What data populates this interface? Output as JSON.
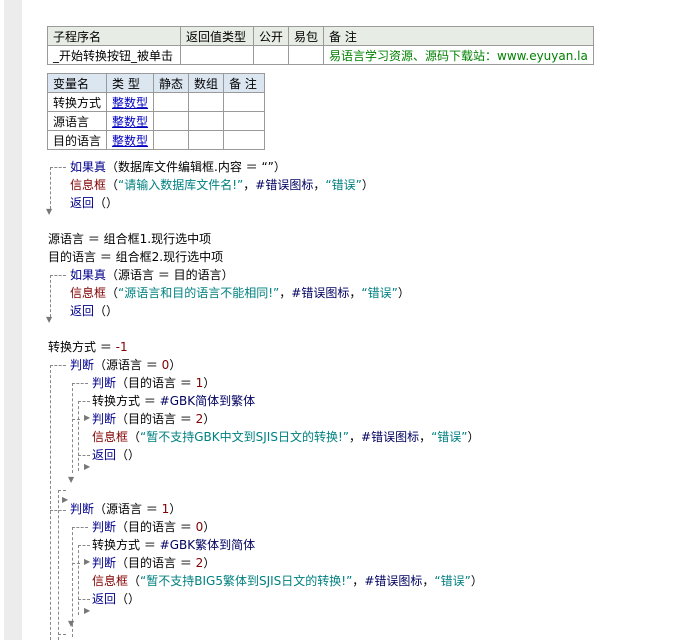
{
  "subroutine_table": {
    "headers": [
      "子程序名",
      "返回值类型",
      "公开",
      "易包",
      "备 注"
    ],
    "row": [
      "_开始转换按钮_被单击",
      "",
      "",
      "",
      "易语言学习资源、源码下载站：www.eyuyan.la"
    ]
  },
  "variable_table": {
    "headers": [
      "变量名",
      "类 型",
      "静态",
      "数组",
      "备 注"
    ],
    "rows": [
      [
        "转换方式",
        "整数型",
        "",
        "",
        ""
      ],
      [
        "源语言",
        "整数型",
        "",
        "",
        ""
      ],
      [
        "目的语言",
        "整数型",
        "",
        "",
        ""
      ]
    ]
  },
  "code_lines": [
    [
      {
        "c": "kw",
        "t": "如果真"
      },
      {
        "c": "plain",
        "t": "（数据库文件编辑框.内容 ＝ “”）"
      }
    ],
    [
      {
        "c": "fn",
        "t": "信息框"
      },
      {
        "c": "plain",
        "t": "（"
      },
      {
        "c": "str",
        "t": "“请输入数据库文件名!”"
      },
      {
        "c": "plain",
        "t": "，"
      },
      {
        "c": "const",
        "t": "#错误图标"
      },
      {
        "c": "plain",
        "t": "，"
      },
      {
        "c": "str",
        "t": "“错误”"
      },
      {
        "c": "plain",
        "t": "）"
      }
    ],
    [
      {
        "c": "kw",
        "t": "返回"
      },
      {
        "c": "plain",
        "t": "（）"
      }
    ],
    [
      {
        "c": "plain",
        "t": "源语言 ＝ 组合框1.现行选中项"
      }
    ],
    [
      {
        "c": "plain",
        "t": "目的语言 ＝ 组合框2.现行选中项"
      }
    ],
    [
      {
        "c": "kw",
        "t": "如果真"
      },
      {
        "c": "plain",
        "t": "（源语言 ＝ 目的语言）"
      }
    ],
    [
      {
        "c": "fn",
        "t": "信息框"
      },
      {
        "c": "plain",
        "t": "（"
      },
      {
        "c": "str",
        "t": "“源语言和目的语言不能相同!”"
      },
      {
        "c": "plain",
        "t": "，"
      },
      {
        "c": "const",
        "t": "#错误图标"
      },
      {
        "c": "plain",
        "t": "，"
      },
      {
        "c": "str",
        "t": "“错误”"
      },
      {
        "c": "plain",
        "t": "）"
      }
    ],
    [
      {
        "c": "kw",
        "t": "返回"
      },
      {
        "c": "plain",
        "t": "（）"
      }
    ],
    [
      {
        "c": "plain",
        "t": "转换方式 ＝ "
      },
      {
        "c": "num",
        "t": "-1"
      }
    ],
    [
      {
        "c": "kw",
        "t": "判断"
      },
      {
        "c": "plain",
        "t": "（源语言 ＝ "
      },
      {
        "c": "num",
        "t": "0"
      },
      {
        "c": "plain",
        "t": "）"
      }
    ],
    [
      {
        "c": "kw",
        "t": "判断"
      },
      {
        "c": "plain",
        "t": "（目的语言 ＝ "
      },
      {
        "c": "num",
        "t": "1"
      },
      {
        "c": "plain",
        "t": "）"
      }
    ],
    [
      {
        "c": "plain",
        "t": "转换方式 ＝ "
      },
      {
        "c": "const",
        "t": "#GBK简体到繁体"
      }
    ],
    [
      {
        "c": "kw",
        "t": "判断"
      },
      {
        "c": "plain",
        "t": "（目的语言 ＝ "
      },
      {
        "c": "num",
        "t": "2"
      },
      {
        "c": "plain",
        "t": "）"
      }
    ],
    [
      {
        "c": "fn",
        "t": "信息框"
      },
      {
        "c": "plain",
        "t": "（"
      },
      {
        "c": "str",
        "t": "“暂不支持GBK中文到SJIS日文的转换!”"
      },
      {
        "c": "plain",
        "t": "，"
      },
      {
        "c": "const",
        "t": "#错误图标"
      },
      {
        "c": "plain",
        "t": "，"
      },
      {
        "c": "str",
        "t": "“错误”"
      },
      {
        "c": "plain",
        "t": "）"
      }
    ],
    [
      {
        "c": "kw",
        "t": "返回"
      },
      {
        "c": "plain",
        "t": "（）"
      }
    ],
    [
      {
        "c": "kw",
        "t": "判断"
      },
      {
        "c": "plain",
        "t": "（源语言 ＝ "
      },
      {
        "c": "num",
        "t": "1"
      },
      {
        "c": "plain",
        "t": "）"
      }
    ],
    [
      {
        "c": "kw",
        "t": "判断"
      },
      {
        "c": "plain",
        "t": "（目的语言 ＝ "
      },
      {
        "c": "num",
        "t": "0"
      },
      {
        "c": "plain",
        "t": "）"
      }
    ],
    [
      {
        "c": "plain",
        "t": "转换方式 ＝ "
      },
      {
        "c": "const",
        "t": "#GBK繁体到简体"
      }
    ],
    [
      {
        "c": "kw",
        "t": "判断"
      },
      {
        "c": "plain",
        "t": "（目的语言 ＝ "
      },
      {
        "c": "num",
        "t": "2"
      },
      {
        "c": "plain",
        "t": "）"
      }
    ],
    [
      {
        "c": "fn",
        "t": "信息框"
      },
      {
        "c": "plain",
        "t": "（"
      },
      {
        "c": "str",
        "t": "“暂不支持BIG5繁体到SJIS日文的转换!”"
      },
      {
        "c": "plain",
        "t": "，"
      },
      {
        "c": "const",
        "t": "#错误图标"
      },
      {
        "c": "plain",
        "t": "，"
      },
      {
        "c": "str",
        "t": "“错误”"
      },
      {
        "c": "plain",
        "t": "）"
      }
    ],
    [
      {
        "c": "kw",
        "t": "返回"
      },
      {
        "c": "plain",
        "t": "（）"
      }
    ]
  ]
}
